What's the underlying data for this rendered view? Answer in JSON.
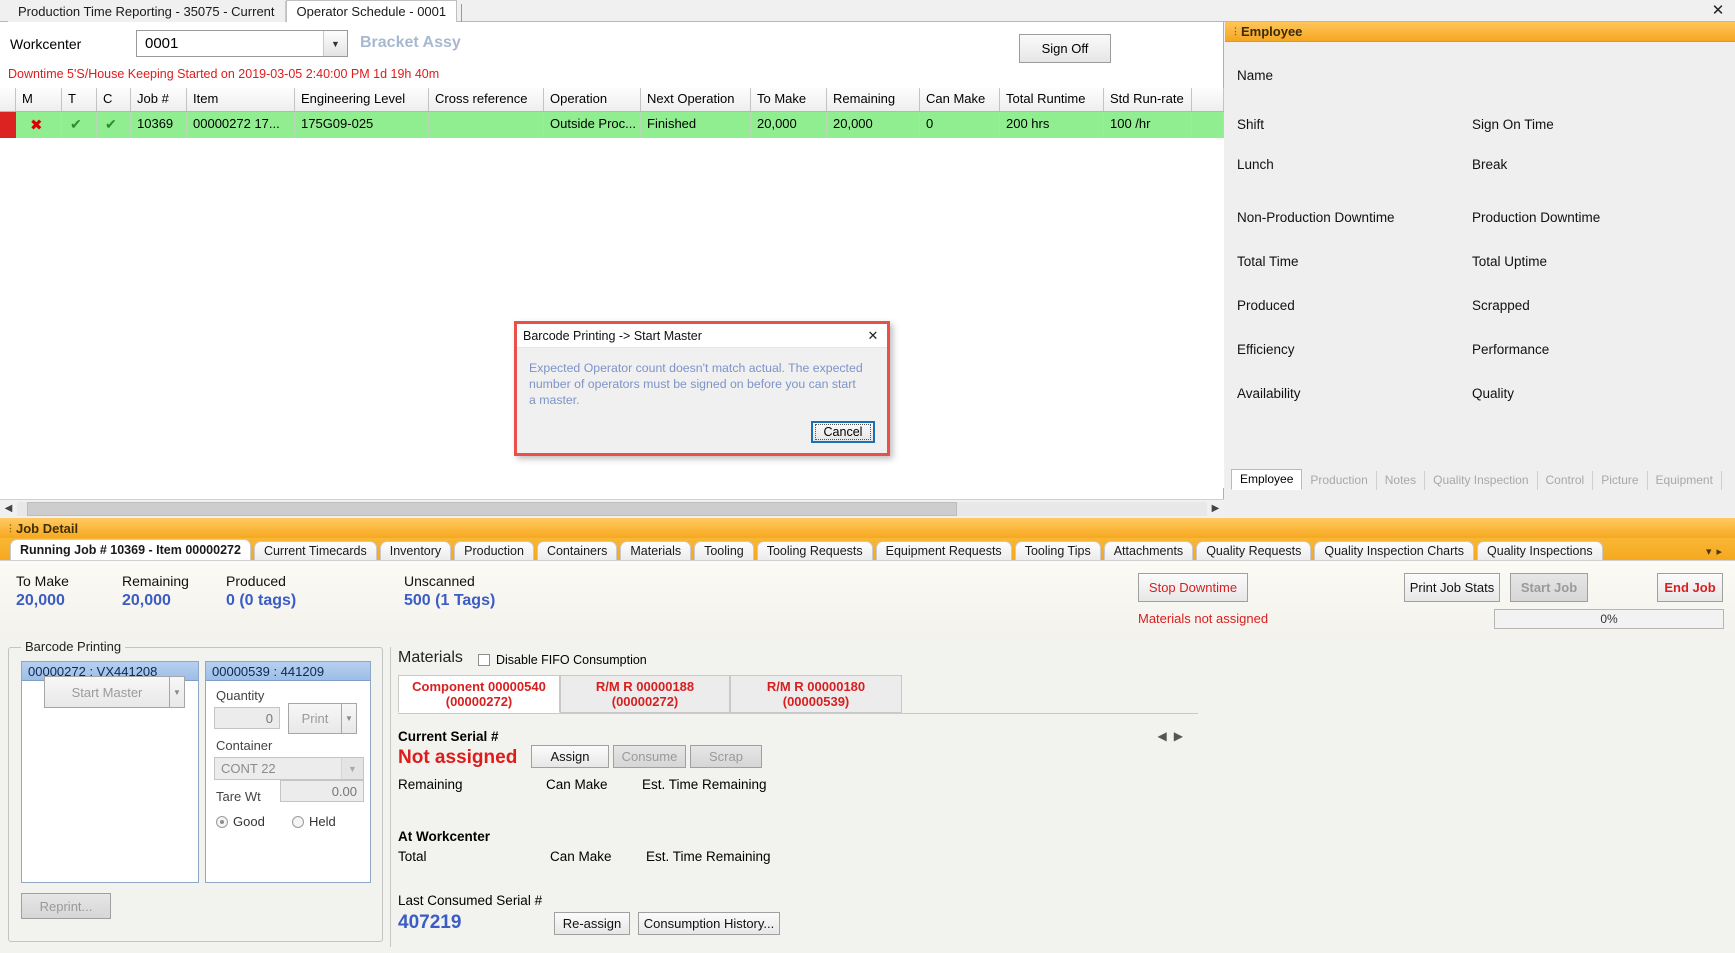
{
  "window": {
    "close_icon": "close-icon",
    "tabs": [
      {
        "label": "Production Time Reporting - 35075 - Current",
        "active": false
      },
      {
        "label": "Operator Schedule - 0001",
        "active": true
      }
    ]
  },
  "workcenter": {
    "label": "Workcenter",
    "value": "0001",
    "description": "Bracket Assy",
    "sign_off_label": "Sign Off"
  },
  "downtime_message": "Downtime 5'S/House Keeping Started on 2019-03-05 2:40:00 PM 1d 19h 40m",
  "grid": {
    "columns": [
      "M",
      "T",
      "C",
      "Job #",
      "Item",
      "Engineering Level",
      "Cross reference",
      "Operation",
      "Next Operation",
      "To Make",
      "Remaining",
      "Can Make",
      "Total Runtime",
      "Std Run-rate"
    ],
    "rows": [
      {
        "m": "✖",
        "t": "✔",
        "c": "✔",
        "job": "10369",
        "item": "00000272  17...",
        "engineering_level": "175G09-025",
        "cross_reference": "",
        "operation": "Outside  Proc...",
        "next_operation": "Finished",
        "to_make": "20,000",
        "remaining": "20,000",
        "can_make": "0",
        "total_runtime": "200 hrs",
        "std_run_rate": "100 /hr"
      }
    ]
  },
  "employee_panel": {
    "header": "Employee",
    "fields": [
      {
        "label": "Name"
      },
      {
        "label": "Shift"
      },
      {
        "label": "Sign On Time"
      },
      {
        "label": "Lunch"
      },
      {
        "label": "Break"
      },
      {
        "label": "Non-Production Downtime"
      },
      {
        "label": "Production Downtime"
      },
      {
        "label": "Total Time"
      },
      {
        "label": "Total Uptime"
      },
      {
        "label": "Produced"
      },
      {
        "label": "Scrapped"
      },
      {
        "label": "Efficiency"
      },
      {
        "label": "Performance"
      },
      {
        "label": "Availability"
      },
      {
        "label": "Quality"
      }
    ],
    "tabs": [
      {
        "label": "Employee",
        "active": true
      },
      {
        "label": "Production",
        "active": false
      },
      {
        "label": "Notes",
        "active": false
      },
      {
        "label": "Quality Inspection",
        "active": false
      },
      {
        "label": "Control",
        "active": false
      },
      {
        "label": "Picture",
        "active": false
      },
      {
        "label": "Equipment",
        "active": false
      }
    ]
  },
  "job_detail": {
    "band_title": "Job Detail",
    "tabs": [
      {
        "label": "Running Job # 10369 - Item 00000272",
        "active": true
      },
      {
        "label": "Current Timecards",
        "active": false
      },
      {
        "label": "Inventory",
        "active": false
      },
      {
        "label": "Production",
        "active": false
      },
      {
        "label": "Containers",
        "active": false
      },
      {
        "label": "Materials",
        "active": false
      },
      {
        "label": "Tooling",
        "active": false
      },
      {
        "label": "Tooling Requests",
        "active": false
      },
      {
        "label": "Equipment Requests",
        "active": false
      },
      {
        "label": "Tooling Tips",
        "active": false
      },
      {
        "label": "Attachments",
        "active": false
      },
      {
        "label": "Quality Requests",
        "active": false
      },
      {
        "label": "Quality Inspection Charts",
        "active": false
      },
      {
        "label": "Quality Inspections",
        "active": false
      }
    ],
    "stats": [
      {
        "label": "To Make",
        "value": "20,000"
      },
      {
        "label": "Remaining",
        "value": "20,000"
      },
      {
        "label": "Produced",
        "value": "0 (0 tags)"
      },
      {
        "label": "Unscanned",
        "value": "500 (1 Tags)"
      }
    ],
    "stop_downtime_label": "Stop Downtime",
    "materials_warning": "Materials not assigned",
    "print_job_stats_label": "Print Job Stats",
    "start_job_label": "Start Job",
    "end_job_label": "End Job",
    "progress_text": "0%"
  },
  "barcode_printing": {
    "legend": "Barcode Printing",
    "left_box": {
      "header": "00000272 : VX441208",
      "start_master_label": "Start Master"
    },
    "right_box": {
      "header": "00000539 : 441209",
      "quantity_label": "Quantity",
      "quantity_value": "0",
      "print_label": "Print",
      "container_label": "Container",
      "container_value": "CONT 22",
      "tare_wt_label": "Tare Wt",
      "tare_wt_value": "0.00",
      "good_label": "Good",
      "held_label": "Held"
    },
    "reprint_label": "Reprint..."
  },
  "materials": {
    "title": "Materials",
    "disable_fifo_label": "Disable FIFO Consumption",
    "tabs": [
      {
        "line1": "Component 00000540",
        "line2": "(00000272)",
        "active": true
      },
      {
        "line1": "R/M R 00000188",
        "line2": "(00000272)",
        "active": false
      },
      {
        "line1": "R/M R 00000180",
        "line2": "(00000539)",
        "active": false
      }
    ],
    "current_serial_label": "Current Serial #",
    "current_serial_value": "Not assigned",
    "remaining_label": "Remaining",
    "can_make_label": "Can Make",
    "est_time_remaining_label": "Est. Time Remaining",
    "assign_label": "Assign",
    "consume_label": "Consume",
    "scrap_label": "Scrap",
    "at_workcenter_label": "At Workcenter",
    "total_label": "Total",
    "can_make_label2": "Can Make",
    "est_time_remaining_label2": "Est. Time Remaining",
    "last_consumed_label": "Last Consumed Serial #",
    "last_consumed_value": "407219",
    "reassign_label": "Re-assign",
    "consumption_history_label": "Consumption History..."
  },
  "dialog": {
    "title": "Barcode Printing -> Start Master",
    "message": "Expected Operator count doesn't match actual. The expected number of operators must be signed on before you can start a master.",
    "cancel_label": "Cancel",
    "close_icon": "close-icon",
    "border_color": "#e8504a"
  }
}
